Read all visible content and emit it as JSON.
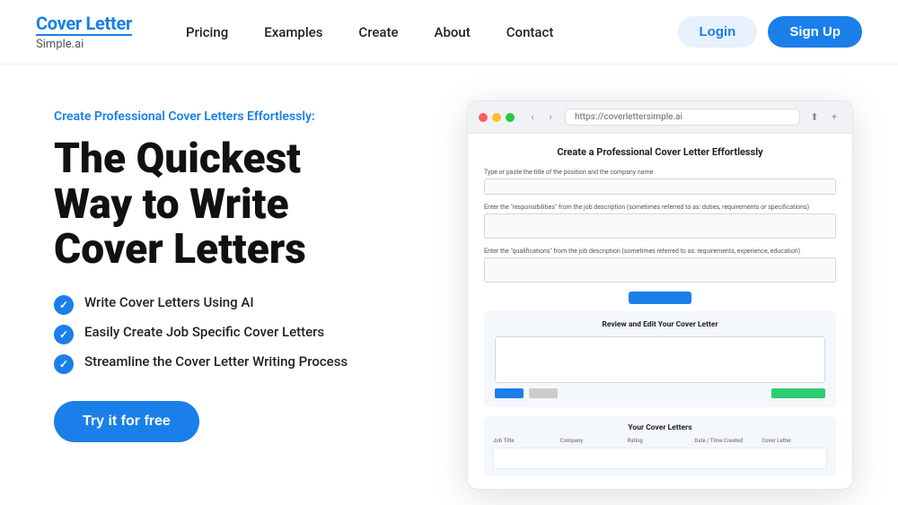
{
  "header": {
    "logo_top": "Cover Letter",
    "logo_bottom": "Simple.ai",
    "nav": [
      {
        "label": "Pricing",
        "href": "#"
      },
      {
        "label": "Examples",
        "href": "#"
      },
      {
        "label": "Create",
        "href": "#"
      },
      {
        "label": "About",
        "href": "#"
      },
      {
        "label": "Contact",
        "href": "#"
      }
    ],
    "login_label": "Login",
    "signup_label": "Sign Up"
  },
  "hero": {
    "subtitle": "Create Professional Cover Letters Effortlessly:",
    "headline_line1": "The Quickest",
    "headline_line2": "Way to Write",
    "headline_line3": "Cover Letters",
    "features": [
      "Write Cover Letters Using AI",
      "Easily Create Job Specific Cover Letters",
      "Streamline the Cover Letter Writing Process"
    ],
    "cta_label": "Try it for free"
  },
  "browser": {
    "url": "https://coverlettersimple.ai",
    "page_title": "Create a Professional Cover Letter Effortlessly",
    "field1_label": "Type or paste the title of the position and the company name",
    "field2_label": "Enter the \"responsibilities\" from the job description (sometimes referred to as: duties, requirements or specifications)",
    "field3_label": "Enter the \"qualifications\" from the job description (sometimes referred to as: requirements, experience, education)",
    "review_title": "Review and Edit Your Cover Letter",
    "table_title": "Your Cover Letters",
    "table_headers": [
      "Job Title",
      "Company",
      "Rating",
      "Date / Time Created",
      "Cover Letter"
    ]
  },
  "icons": {
    "back_arrow": "‹",
    "forward_arrow": "›",
    "share": "⬆",
    "new_tab": "+"
  }
}
